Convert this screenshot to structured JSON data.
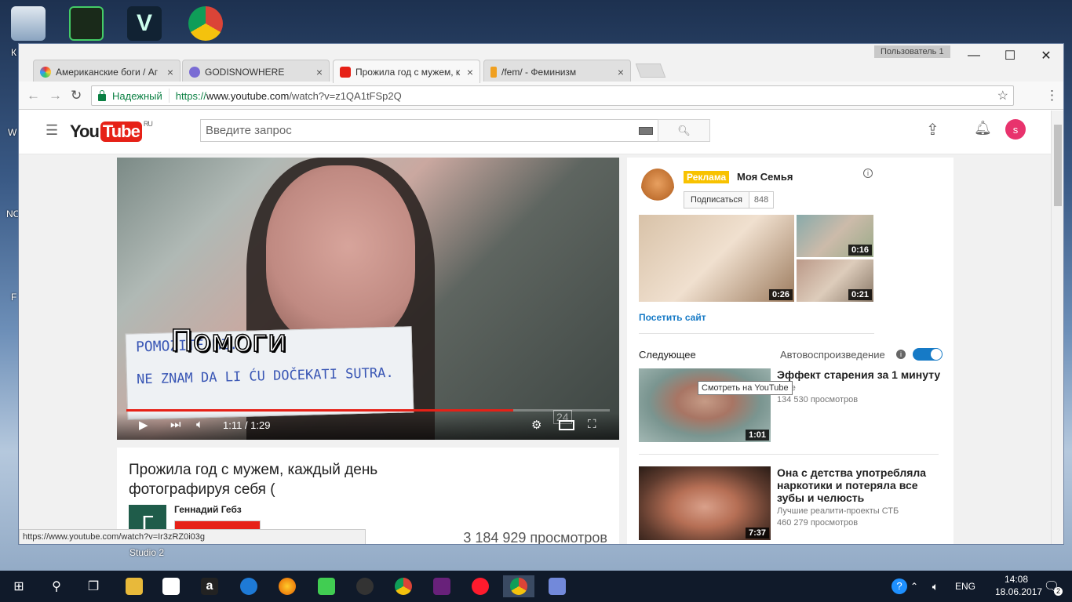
{
  "desktop": {
    "icons": [
      {
        "name": "recycle-bin-icon",
        "label": "К"
      },
      {
        "name": "second-life-icon",
        "label": ""
      },
      {
        "name": "vegas-icon",
        "label": ""
      },
      {
        "name": "chrome-desktop-icon",
        "label": ""
      }
    ],
    "side_labels": [
      "W",
      "NC",
      "F",
      "Studio 2"
    ]
  },
  "browser": {
    "profile_badge": "Пользователь 1",
    "tabs": [
      {
        "title": "Американские боги / Аг",
        "color": "#e8a23a"
      },
      {
        "title": "GODISNOWHERE",
        "color": "#7a6cd4"
      },
      {
        "title": "Прожила год с мужем, к",
        "color": "#e62117"
      },
      {
        "title": "/fem/ - Феминизм",
        "color": "#f0a020"
      }
    ],
    "tab_close": "×",
    "window_controls": {
      "minimize": "—",
      "maximize": "☐",
      "close": "✕"
    },
    "secure_label": "Надежный",
    "url_scheme": "https://",
    "url_host": "www.youtube.com",
    "url_path": "/watch?v=z1QA1tFSp2Q",
    "status_url": "https://www.youtube.com/watch?v=Ir3zRZ0i03g"
  },
  "youtube": {
    "logo_text": "You",
    "logo_tube": "Tube",
    "logo_region": "RU",
    "search_placeholder": "Введите запрос",
    "avatar_letter": "s",
    "video": {
      "subtitle": "Помоги",
      "paper_line1": "POMOZITE MI.",
      "paper_line2": "NE ZNAM DA LI ĆU DOČEKATI SUTRA.",
      "time": "1:11 / 1:29",
      "progress": 0.8,
      "watermark": "24",
      "title": "Прожила год с мужем, каждый день фотографируя себя (",
      "channel": "Геннадий Гебз",
      "channel_initial": "Г",
      "views": "3 184 929 просмотров"
    },
    "ad": {
      "badge": "Реклама",
      "channel": "Моя Семья",
      "subscribe": "Подписаться",
      "subscribers": "848",
      "durations": [
        "0:26",
        "0:16",
        "0:21"
      ],
      "visit_link": "Посетить сайт",
      "tooltip": "Смотреть на YouTube"
    },
    "up_next": {
      "label": "Следующее",
      "autoplay": "Автовоспроизведение",
      "items": [
        {
          "title": "Эффект старения за 1 минуту",
          "channel": "base",
          "views": "134 530 просмотров",
          "duration": "1:01"
        },
        {
          "title": "Она с детства употребляла наркотики и потеряла все зубы и челюсть",
          "channel": "Лучшие реалити-проекты СТБ",
          "views": "460 279 просмотров",
          "duration": "7:37"
        }
      ]
    }
  },
  "taskbar": {
    "lang": "ENG",
    "time": "14:08",
    "date": "18.06.2017",
    "notifications": "2"
  }
}
